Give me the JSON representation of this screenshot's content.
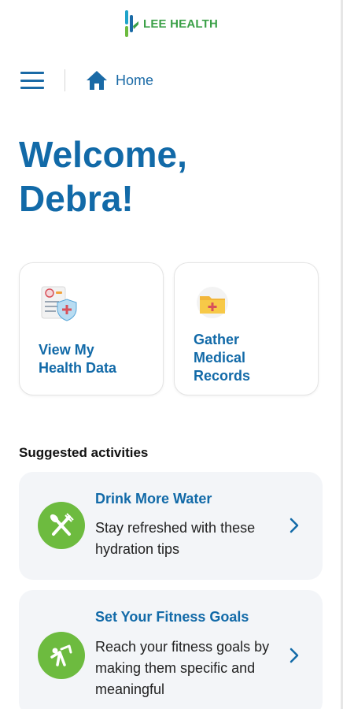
{
  "header": {
    "logo_text": "LEE HEALTH",
    "logo_icon": "lee-health-logo-icon",
    "brand_color": "#3aa047"
  },
  "nav": {
    "menu_icon": "hamburger-menu-icon",
    "home_icon": "home-icon",
    "breadcrumb_home": "Home"
  },
  "welcome": {
    "line1": "Welcome,",
    "line2": "Debra!"
  },
  "quick_actions": [
    {
      "line1": "View My",
      "line2": "Health Data",
      "icon": "health-record-shield-icon"
    },
    {
      "line1": "Gather",
      "line2": "Medical",
      "line3": "Records",
      "icon": "medical-folder-icon"
    }
  ],
  "suggested": {
    "title": "Suggested activities",
    "items": [
      {
        "title": "Drink More Water",
        "description": "Stay refreshed with these hydration tips",
        "icon": "fork-knife-icon"
      },
      {
        "title": "Set Your Fitness Goals",
        "description": "Reach your fitness goals by making them specific and meaningful",
        "icon": "exercise-person-icon"
      }
    ]
  },
  "colors": {
    "primary": "#126aa8",
    "activity_icon_bg": "#6dbb3f",
    "card_bg": "#f3f5f8"
  }
}
